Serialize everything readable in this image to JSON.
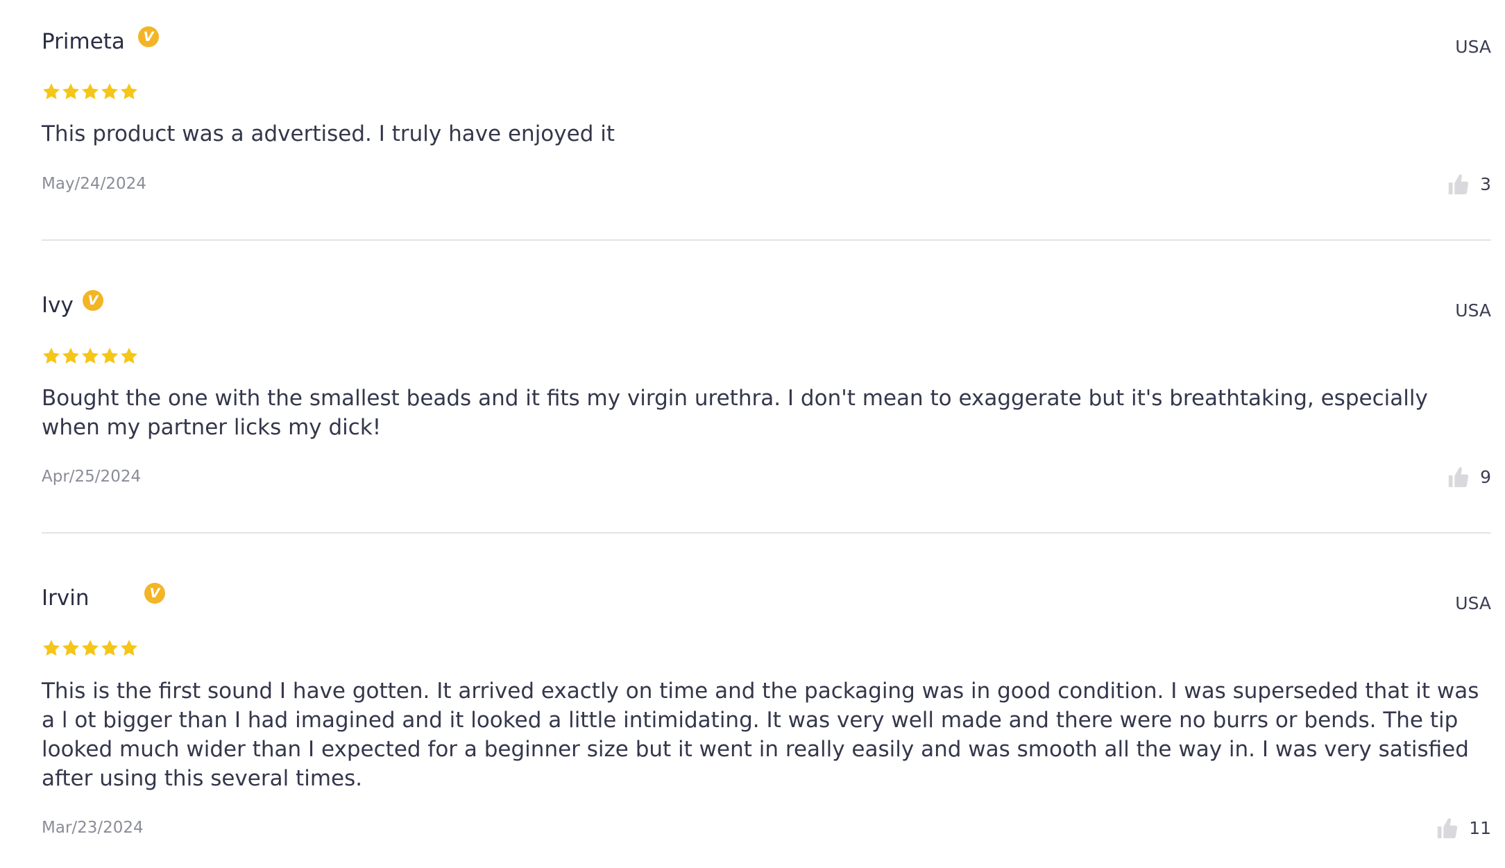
{
  "colors": {
    "star": "#f5c518",
    "verified_badge": "#f3b526",
    "divider": "#e4e4e8",
    "thumb_icon": "#d9d9dd"
  },
  "reviews": [
    {
      "name": "Primeta",
      "verified_label": "V",
      "country": "USA",
      "rating": 5,
      "text": "This product was a advertised. I truly have enjoyed it",
      "date": "May/24/2024",
      "helpful_count": "3"
    },
    {
      "name": "Ivy",
      "verified_label": "V",
      "country": "USA",
      "rating": 5,
      "text": "Bought the one with the smallest beads and it fits my virgin urethra. I don't mean to exaggerate but it's breathtaking, especially when my partner licks my dick!",
      "date": "Apr/25/2024",
      "helpful_count": "9"
    },
    {
      "name": "Irvin",
      "verified_label": "V",
      "country": "USA",
      "rating": 5,
      "text": "This is the first sound I have gotten. It arrived exactly on time and the packaging was in good condition. I was superseded that it was a l ot bigger than I had imagined and it looked a little intimidating. It was very well made and there were no burrs or bends. The tip looked much wider than I expected for a beginner size but it went in really easily and was smooth all the way in. I was very satisfied after using this several times.",
      "date": "Mar/23/2024",
      "helpful_count": "11"
    }
  ]
}
